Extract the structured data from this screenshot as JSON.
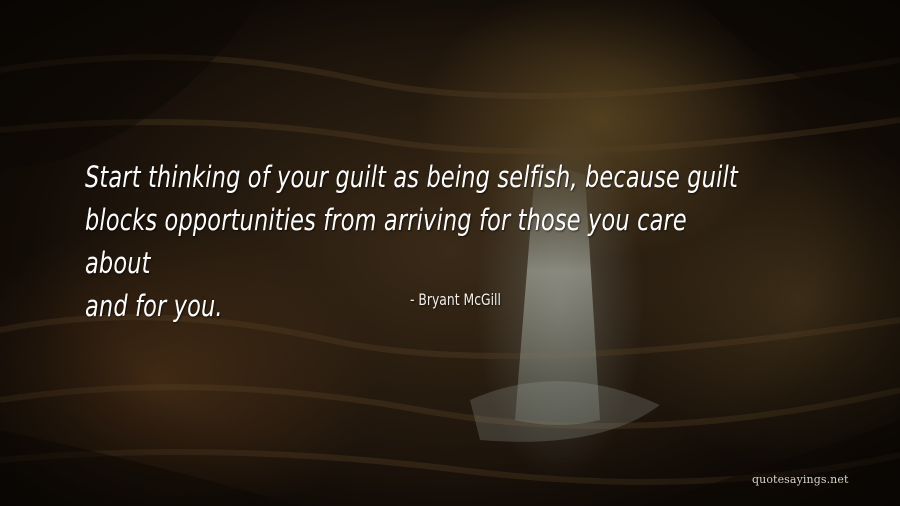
{
  "quote": {
    "line1": "Start thinking of your guilt as being selfish, because guilt",
    "line2": "blocks opportunities from arriving for those you care about",
    "line3": "and for you."
  },
  "author": "- Bryant McGill",
  "watermark": "quotesayings.net",
  "colors": {
    "text": "#ffffff",
    "background_dark": "#140d07",
    "background_rock": "#3a2a18"
  }
}
